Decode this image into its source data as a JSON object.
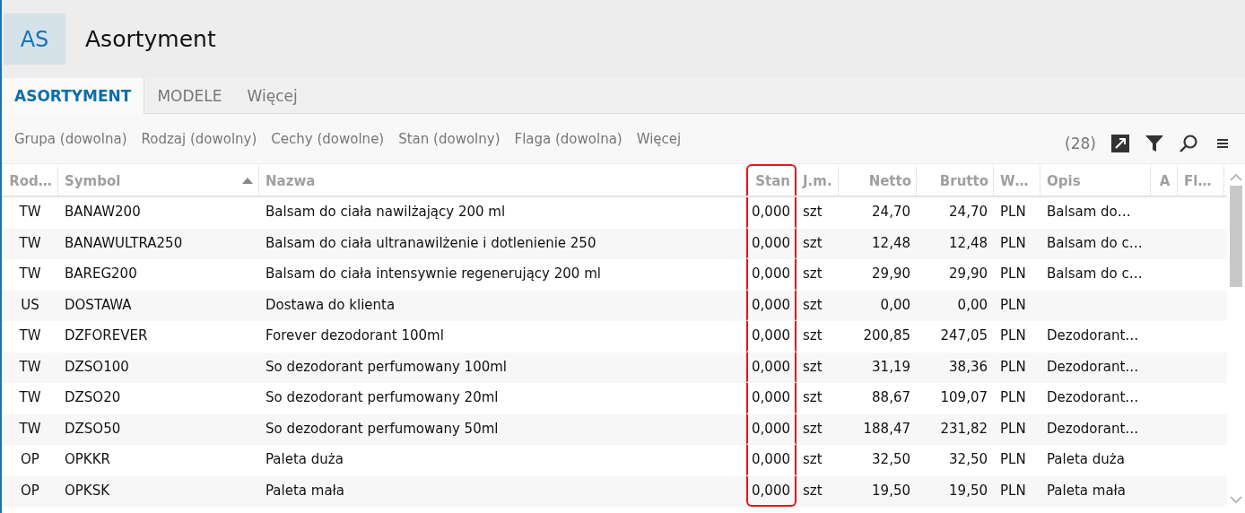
{
  "header": {
    "badge": "AS",
    "title": "Asortyment"
  },
  "tabs": [
    {
      "label": "ASORTYMENT",
      "selected": true
    },
    {
      "label": "MODELE",
      "selected": false
    },
    {
      "label": "Więcej",
      "selected": false
    }
  ],
  "filters": [
    "Grupa (dowolna)",
    "Rodzaj (dowolny)",
    "Cechy (dowolne)",
    "Stan (dowolny)",
    "Flaga (dowolna)",
    "Więcej"
  ],
  "count": "(28)",
  "table": {
    "columns": [
      {
        "label": "Rod…",
        "sorted": false,
        "highlighted": false
      },
      {
        "label": "Symbol",
        "sorted": true,
        "highlighted": false
      },
      {
        "label": "Nazwa",
        "sorted": false,
        "highlighted": false
      },
      {
        "label": "Stan",
        "sorted": false,
        "highlighted": true
      },
      {
        "label": "J.m.",
        "sorted": false,
        "highlighted": false
      },
      {
        "label": "Netto",
        "sorted": false,
        "highlighted": false
      },
      {
        "label": "Brutto",
        "sorted": false,
        "highlighted": false
      },
      {
        "label": "W…",
        "sorted": false,
        "highlighted": false
      },
      {
        "label": "Opis",
        "sorted": false,
        "highlighted": false
      },
      {
        "label": "A",
        "sorted": false,
        "highlighted": false
      },
      {
        "label": "Fl…",
        "sorted": false,
        "highlighted": false
      }
    ],
    "rows": [
      {
        "cells": [
          "TW",
          "BANAW200",
          "Balsam do ciała nawilżający 200 ml",
          "0,000",
          "szt",
          "24,70",
          "24,70",
          "PLN",
          "Balsam do…",
          "",
          ""
        ]
      },
      {
        "cells": [
          "TW",
          "BANAWULTRA250",
          "Balsam do ciała ultranawilżenie i dotlenienie 250",
          "0,000",
          "szt",
          "12,48",
          "12,48",
          "PLN",
          "Balsam do c…",
          "",
          ""
        ]
      },
      {
        "cells": [
          "TW",
          "BAREG200",
          "Balsam do ciała intensywnie regenerujący 200 ml",
          "0,000",
          "szt",
          "29,90",
          "29,90",
          "PLN",
          "Balsam do c…",
          "",
          ""
        ]
      },
      {
        "cells": [
          "US",
          "DOSTAWA",
          "Dostawa do klienta",
          "0,000",
          "szt",
          "0,00",
          "0,00",
          "PLN",
          "",
          "",
          ""
        ]
      },
      {
        "cells": [
          "TW",
          "DZFOREVER",
          "Forever dezodorant 100ml",
          "0,000",
          "szt",
          "200,85",
          "247,05",
          "PLN",
          "Dezodorant…",
          "",
          ""
        ]
      },
      {
        "cells": [
          "TW",
          "DZSO100",
          "So dezodorant perfumowany 100ml",
          "0,000",
          "szt",
          "31,19",
          "38,36",
          "PLN",
          "Dezodorant…",
          "",
          ""
        ]
      },
      {
        "cells": [
          "TW",
          "DZSO20",
          "So dezodorant perfumowany 20ml",
          "0,000",
          "szt",
          "88,67",
          "109,07",
          "PLN",
          "Dezodorant…",
          "",
          ""
        ]
      },
      {
        "cells": [
          "TW",
          "DZSO50",
          "So dezodorant perfumowany 50ml",
          "0,000",
          "szt",
          "188,47",
          "231,82",
          "PLN",
          "Dezodorant…",
          "",
          ""
        ]
      },
      {
        "cells": [
          "OP",
          "OPKKR",
          "Paleta duża",
          "0,000",
          "szt",
          "32,50",
          "32,50",
          "PLN",
          "Paleta duża",
          "",
          ""
        ]
      },
      {
        "cells": [
          "OP",
          "OPKSK",
          "Paleta mała",
          "0,000",
          "szt",
          "19,50",
          "19,50",
          "PLN",
          "Paleta mała",
          "",
          ""
        ]
      }
    ]
  }
}
